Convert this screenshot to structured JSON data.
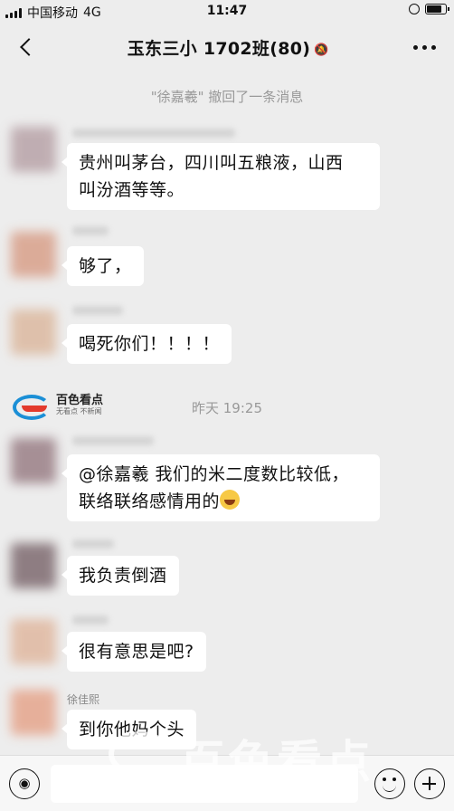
{
  "status_bar": {
    "carrier": "中国移动",
    "network": "4G",
    "time": "11:47"
  },
  "nav": {
    "title": "玉东三小 1702班(80)",
    "mute_icon": "bell-off-icon"
  },
  "recall_notice": "\"徐嘉羲\" 撤回了一条消息",
  "messages": [
    {
      "text": "贵州叫茅台，四川叫五粮液，山西\n叫汾酒等等。",
      "avatar_color": "#b8a3a8"
    },
    {
      "text": "够了，",
      "avatar_color": "#d8a08a"
    },
    {
      "text": "喝死你们！！！！",
      "avatar_color": "#dcb9a0"
    },
    {
      "text_part1": "@徐嘉羲 我们的米二度数比较低，",
      "text_part2": "联络联络感情用的",
      "avatar_color": "#9a7f86"
    },
    {
      "text": "我负责倒酒",
      "avatar_color": "#7e6a70"
    },
    {
      "text": "很有意思是吧?",
      "avatar_color": "#e0b8a0"
    },
    {
      "sender": "徐佳熙",
      "text": "到你他妈个头",
      "avatar_color": "#e5a58c"
    }
  ],
  "time_divider": "昨天 19:25",
  "logo": {
    "title": "百色看点",
    "subtitle": "无看点  不新闻"
  },
  "watermark": {
    "small": "百色看点",
    "big": "百色看点"
  },
  "colors": {
    "background": "#ededed",
    "bubble": "#ffffff",
    "muted_text": "#999999"
  }
}
